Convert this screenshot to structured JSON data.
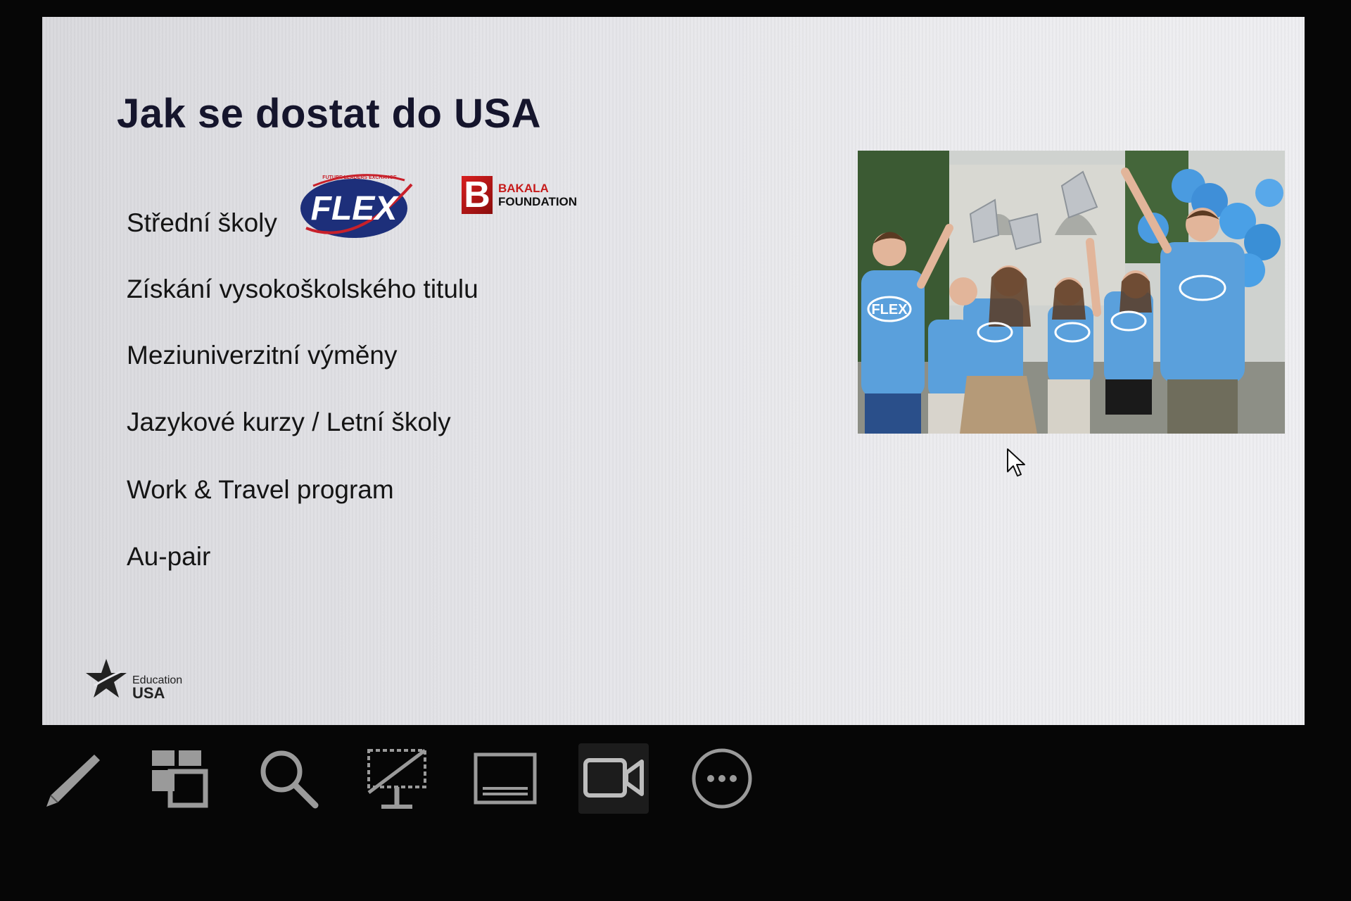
{
  "slide": {
    "title": "Jak se dostat do USA",
    "items": [
      "Střední školy",
      "Získání vysokoškolského titulu",
      "Meziuniverzitní výměny",
      "Jazykové kurzy / Letní školy",
      "Work & Travel program",
      "Au-pair"
    ],
    "flex_logo": {
      "text": "FLEX",
      "arc_text": "FUTURE LEADERS EXCHANGE"
    },
    "bakala_logo": {
      "letter": "B",
      "line1": "BAKALA",
      "line2": "FOUNDATION"
    },
    "photo": {
      "shirt_text": "FLEX"
    },
    "footer_logo": {
      "line1": "Education",
      "line2": "USA"
    }
  },
  "toolbar": {
    "tools": [
      {
        "name": "pen-icon",
        "active": false
      },
      {
        "name": "all-slides-icon",
        "active": false
      },
      {
        "name": "zoom-icon",
        "active": false
      },
      {
        "name": "black-screen-icon",
        "active": false
      },
      {
        "name": "subtitles-icon",
        "active": false
      },
      {
        "name": "camera-icon",
        "active": true
      },
      {
        "name": "more-options-icon",
        "active": false
      }
    ]
  },
  "colors": {
    "background": "#060606",
    "slide": "#e6e6ea",
    "title": "#15152c",
    "flex_blue": "#1d2f7a",
    "bakala_red": "#c61a1a",
    "shirt_blue": "#5aa0dc"
  }
}
